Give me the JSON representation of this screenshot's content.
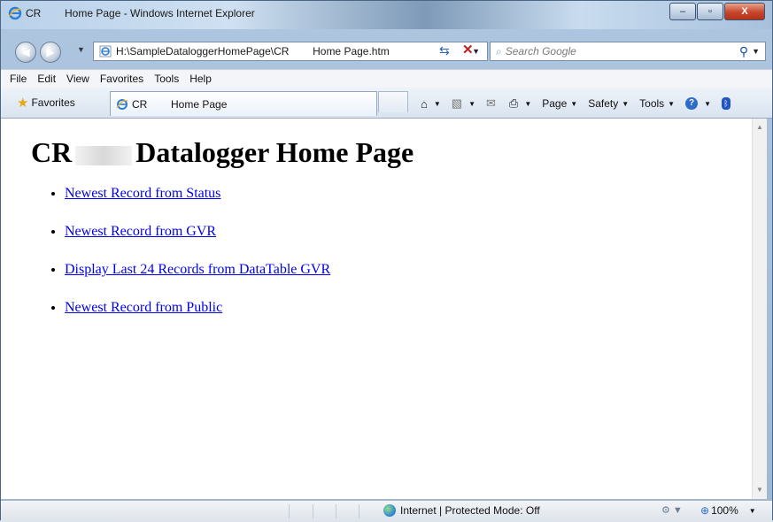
{
  "window": {
    "title": "CR        Home Page - Windows Internet Explorer",
    "minimize_glyph": "–",
    "maximize_glyph": "▫",
    "close_glyph": "X"
  },
  "address_bar": {
    "url": "H:\\SampleDataloggerHomePage\\CR        Home Page.htm",
    "page_icon": "ie-page-icon",
    "refresh_icon": "refresh-icon",
    "stop_icon": "stop-icon"
  },
  "search": {
    "placeholder": "Search Google",
    "go_icon": "search-icon"
  },
  "menu": [
    "File",
    "Edit",
    "View",
    "Favorites",
    "Tools",
    "Help"
  ],
  "favorites": {
    "label": "Favorites",
    "icon": "star-icon"
  },
  "tab": {
    "title": "CR        Home Page"
  },
  "command_bar": {
    "page": "Page",
    "safety": "Safety",
    "tools": "Tools",
    "icons": [
      "home-icon",
      "feeds-icon",
      "mail-icon",
      "print-icon",
      "help-icon",
      "bluetooth-icon"
    ]
  },
  "content": {
    "heading_prefix": "CR",
    "heading_suffix": "Datalogger Home Page",
    "links": [
      "Newest Record from Status",
      "Newest Record from GVR",
      "Display Last 24 Records from DataTable GVR",
      "Newest Record from Public"
    ]
  },
  "status": {
    "zone": "Internet | Protected Mode: Off",
    "zoom": "100%"
  },
  "colors": {
    "link": "#0000ee",
    "close_button": "#c6452b",
    "accent": "#2c6dc7"
  }
}
